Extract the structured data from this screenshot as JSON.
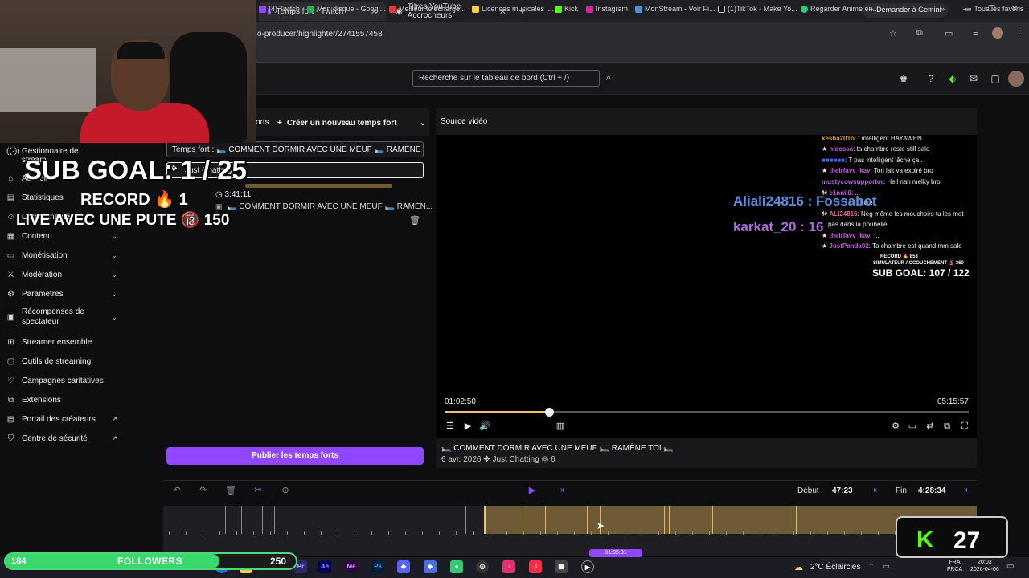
{
  "browser": {
    "tabs": [
      {
        "label": "Temps fort - Twitch"
      },
      {
        "label": "Titres YouTube Accrocheurs"
      }
    ],
    "gemini_label": "Demander à Gemini",
    "url": "o-producer/highlighter/2741557458",
    "bookmarks": [
      "(4) Twitch",
      "Mon disque - Googl...",
      "Meilleur télécharge...",
      "Licences musicales l...",
      "Kick",
      "Instagram",
      "MonStream - Voir Fi...",
      "(1)TikTok - Make Yo...",
      "Regarder Anime en..."
    ],
    "all_tabs_label": "Tous les favoris"
  },
  "twitch": {
    "search_placeholder": "Recherche sur le tableau de bord (Ctrl + /)"
  },
  "sidebar": {
    "items": [
      {
        "label": "Gestionnaire de stream",
        "icon": "antenna-icon"
      },
      {
        "label": "Accueil",
        "icon": "home-icon"
      },
      {
        "label": "Statistiques",
        "icon": "chart-icon"
      },
      {
        "label": "Communauté",
        "icon": "people-icon",
        "expandable": true
      },
      {
        "label": "Contenu",
        "icon": "film-icon",
        "expandable": true
      },
      {
        "label": "Monétisation",
        "icon": "money-icon",
        "expandable": true
      },
      {
        "label": "Modération",
        "icon": "sword-icon",
        "expandable": true
      },
      {
        "label": "Paramètres",
        "icon": "gear-icon",
        "expandable": true
      },
      {
        "label": "Récompenses de spectateur",
        "icon": "gift-icon",
        "expandable": true
      },
      {
        "label": "Streamer ensemble",
        "icon": "collab-icon"
      },
      {
        "label": "Outils de streaming",
        "icon": "tools-icon"
      },
      {
        "label": "Campagnes caritatives",
        "icon": "heart-icon"
      },
      {
        "label": "Extensions",
        "icon": "puzzle-icon"
      },
      {
        "label": "Portail des créateurs",
        "icon": "portal-icon",
        "external": true
      },
      {
        "label": "Centre de sécurité",
        "icon": "shield-icon",
        "external": true
      }
    ]
  },
  "highlighter": {
    "header_partial": "orts",
    "create_label": "Créer un nouveau temps fort",
    "title_value": "Temps fort : 🛏️ COMMENT DORMIR AVEC UNE MEUF 🛏️ RAMÈNE TC",
    "category": "Just Chatting",
    "clip_duration": "3:41:11",
    "clip_title": "🛏️ COMMENT DORMIR AVEC UNE MEUF 🛏️ RAMÈN...",
    "publish_label": "Publier les temps forts"
  },
  "video": {
    "label": "Source vidéo",
    "current_time": "01:02:50",
    "total_time": "05:15:57",
    "progress": 0.2,
    "title": "🛏️ COMMENT DORMIR AVEC UNE MEUF 🛏️ RAMÈNE TOI 🛏️",
    "date": "6 avr. 2026",
    "category": "Just Chatting",
    "views": "6",
    "overlay": {
      "name1": "Aliali24816 : Fossabot",
      "name2": "karkat_20 : 16",
      "subgoal": "SUB GOAL: 107 / 122",
      "record": "RECORD 🔥 853",
      "simulateur": "SIMULATEUR ACCOUCHEMENT 🤰 360",
      "chat": [
        {
          "user": "kesha201o",
          "msg": "t intelligent HAYAWEN"
        },
        {
          "user": "nidessa",
          "msg": "ta chambre reste still sale"
        },
        {
          "user": "",
          "msg": "T pas intelligent lâche ça.."
        },
        {
          "user": "theirfavv_kay",
          "msg": "Ton lait va expiré bro"
        },
        {
          "user": "mustycowsupportor",
          "msg": "Hell nah melky bro"
        },
        {
          "user": "c1nnil0",
          "msg": "..."
        },
        {
          "user": "",
          "msg": "bête"
        },
        {
          "user": "ALI24816",
          "msg": "Neg même les mouchoirs tu les met"
        },
        {
          "user": "",
          "msg": "pas dans la poubelle"
        },
        {
          "user": "theirfavv_kay",
          "msg": "..."
        },
        {
          "user": "JustPanda02",
          "msg": "Ta chambre est quand mm sale"
        }
      ]
    }
  },
  "timeline": {
    "debut_label": "Début",
    "debut_value": "47:23",
    "fin_label": "Fin",
    "fin_value": "4:28:34",
    "scrubber_time": "01:05:31"
  },
  "taskbar": {
    "weather": "2°C Éclaircies",
    "lang": "FRA\nFRCA",
    "time": "20:03",
    "date": "2026-04-06"
  },
  "stream_overlay": {
    "subgoal": "SUB GOAL: 1 / 25",
    "record": "RECORD 🔥 1",
    "live": "LIVE AVEC UNE PUTE 🔞 150",
    "followers_current": "184",
    "followers_label": "FOLLOWERS",
    "followers_goal": "250",
    "followers_progress": 0.736,
    "kick_count": "27",
    "kick_logo": "K"
  },
  "colors": {
    "accent": "#9147ff",
    "highlight": "#e8c56e",
    "followers": "#3ad76d",
    "kick": "#53fc18"
  }
}
